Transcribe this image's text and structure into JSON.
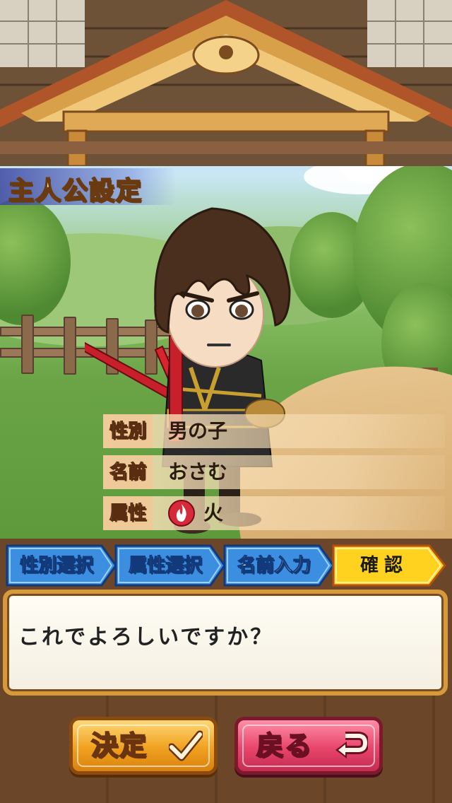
{
  "screen": {
    "title": "主人公設定"
  },
  "profile": {
    "gender_label": "性別",
    "gender_value": "男の子",
    "name_label": "名前",
    "name_value": "おさむ",
    "element_label": "属性",
    "element_value": "火",
    "element_icon": "fire-icon"
  },
  "steps": [
    {
      "label": "性別選択",
      "state": "done"
    },
    {
      "label": "属性選択",
      "state": "done"
    },
    {
      "label": "名前入力",
      "state": "done"
    },
    {
      "label": "確認",
      "state": "active"
    }
  ],
  "dialog": {
    "message": "これでよろしいですか？"
  },
  "buttons": {
    "confirm_label": "決定",
    "confirm_icon": "checkmark-icon",
    "back_label": "戻る",
    "back_icon": "return-arrow-icon"
  },
  "colors": {
    "step_done": "#3c8fe0",
    "step_active": "#ffd21f",
    "confirm_button": "#f0a11e",
    "back_button": "#e8456a",
    "frame_wood": "#6b4628"
  }
}
